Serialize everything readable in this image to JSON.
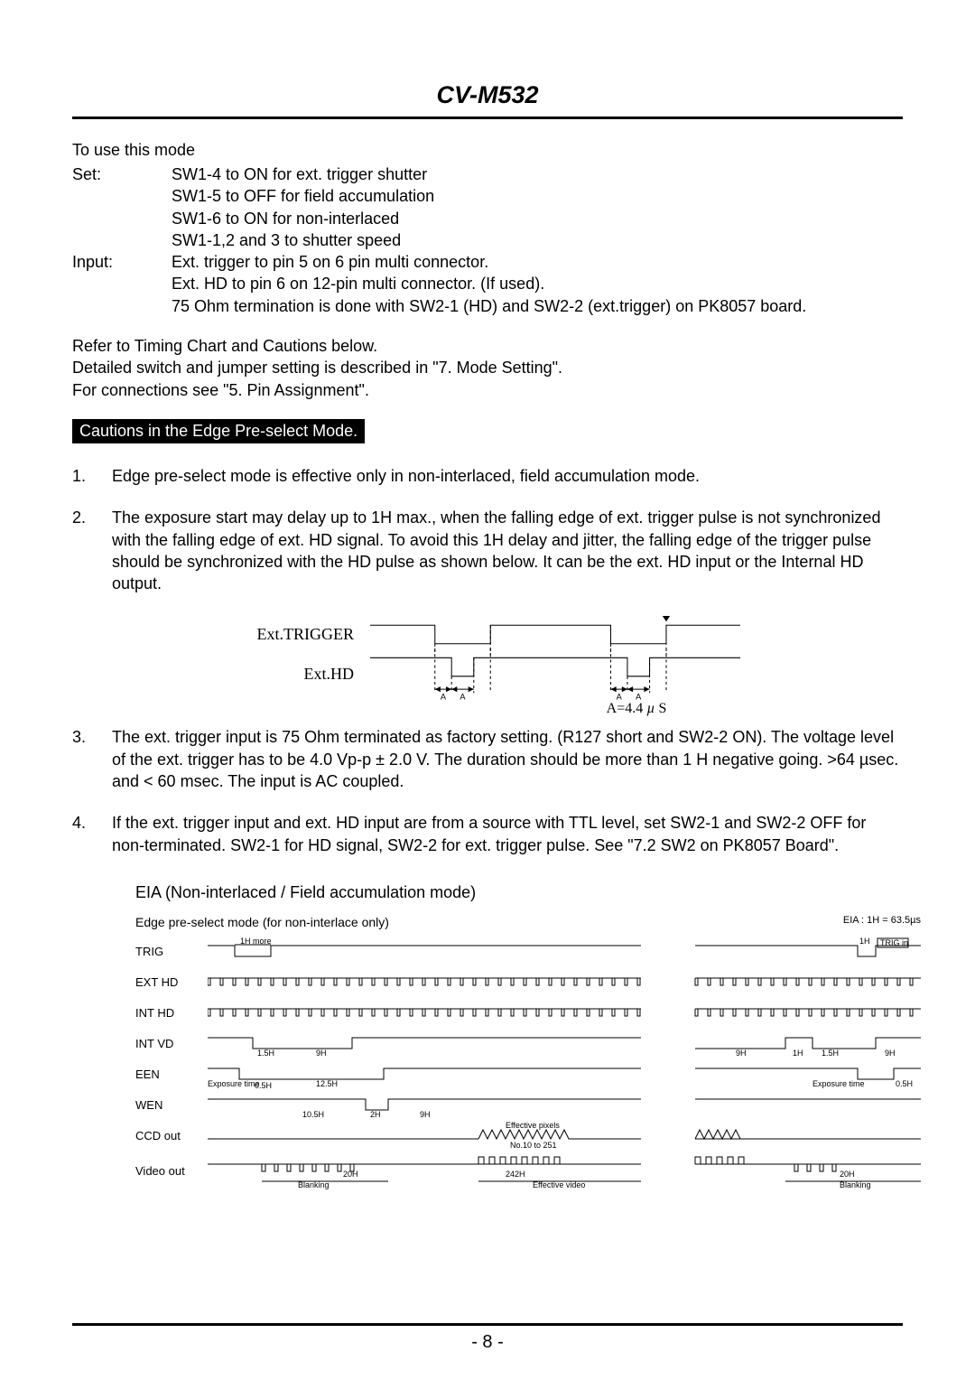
{
  "header": {
    "model": "CV-M532"
  },
  "use_mode": {
    "heading": "To use this mode",
    "rows": [
      {
        "key": "Set:",
        "lines": [
          "SW1-4 to ON for ext. trigger shutter",
          "SW1-5 to OFF for field accumulation",
          "SW1-6 to ON for non-interlaced",
          "SW1-1,2 and 3 to shutter speed"
        ]
      },
      {
        "key": "Input:",
        "lines": [
          "Ext. trigger to pin 5 on 6 pin multi connector.",
          "Ext. HD to pin 6 on 12-pin multi connector. (If used).",
          "75 Ohm termination is done with SW2-1 (HD) and SW2-2 (ext.trigger) on PK8057 board."
        ]
      }
    ]
  },
  "refer": [
    "Refer to Timing Chart and Cautions below.",
    "Detailed switch and jumper setting is described in \"7. Mode Setting\".",
    "For connections see \"5. Pin Assignment\"."
  ],
  "cautions_title": "Cautions in the Edge Pre-select Mode.",
  "cautions": [
    "Edge pre-select mode is effective only in non-interlaced, field accumulation mode.",
    "The exposure start may delay up to 1H max., when the falling edge of ext. trigger pulse is not synchronized with the falling edge of ext. HD signal. To avoid this 1H delay and jitter, the falling edge of the trigger pulse should be synchronized with the HD pulse as shown below. It can be the ext. HD input or the Internal HD output.",
    "The ext. trigger input is 75 Ohm terminated as factory setting. (R127 short and SW2-2 ON). The voltage level of the ext. trigger has to be 4.0 Vp-p ± 2.0 V. The duration should be more than 1 H negative going. >64 µsec. and < 60 msec. The input is AC coupled.",
    "If the ext. trigger input and ext. HD input are from a source with TTL level, set SW2-1 and SW2-2 OFF for non-terminated. SW2-1 for HD signal, SW2-2 for ext. trigger pulse. See \"7.2 SW2 on PK8057 Board\"."
  ],
  "timing1": {
    "trigger_label": "Ext.TRIGGER",
    "hd_label": "Ext.HD",
    "a_label": "A",
    "a_eq": "A=4.4 µ S"
  },
  "chart": {
    "title": "EIA (Non-interlaced / Field accumulation mode)",
    "subtitle": "Edge pre-select mode (for non-interlace only)",
    "eia_note": "EIA : 1H = 63.5µs",
    "signals": [
      "TRIG",
      "EXT HD",
      "INT HD",
      "INT VD",
      "EEN",
      "WEN",
      "CCD out",
      "Video out"
    ],
    "annotations": {
      "trig_1h_more": "1H more",
      "trig_1h": "1H",
      "trig_in": "TRIG in",
      "intvd_1_5h": "1.5H",
      "intvd_9h": "9H",
      "intvd_1h": "1H",
      "een_exposure": "Exposure time",
      "een_0_5h": "0.5H",
      "een_12_5h": "12.5H",
      "wen_10_5h": "10.5H",
      "wen_2h": "2H",
      "wen_9h": "9H",
      "ccd_eff_pixels": "Effective pixels",
      "ccd_no": "No.10 to 251",
      "video_20h": "20H",
      "video_242h": "242H",
      "video_blanking": "Blanking",
      "video_eff": "Effective video"
    }
  },
  "page_number": "- 8 -"
}
